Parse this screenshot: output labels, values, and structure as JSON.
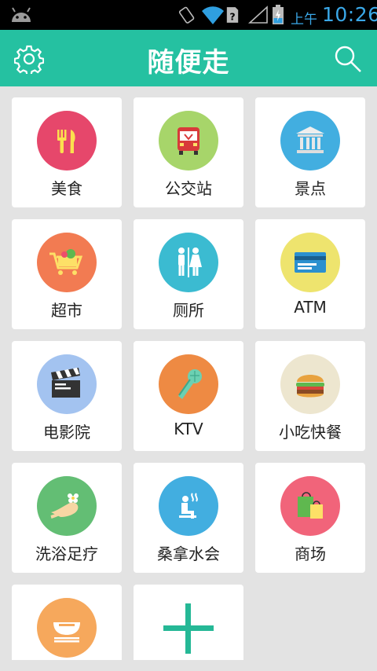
{
  "status_bar": {
    "ampm": "上午",
    "time": "10:26"
  },
  "header": {
    "title": "随便走"
  },
  "categories": [
    {
      "label": "美食",
      "icon": "cutlery-icon",
      "color": "#e6476b"
    },
    {
      "label": "公交站",
      "icon": "bus-icon",
      "color": "#a7d56a"
    },
    {
      "label": "景点",
      "icon": "landmark-icon",
      "color": "#42aee0"
    },
    {
      "label": "超市",
      "icon": "shopping-cart-icon",
      "color": "#f27b52"
    },
    {
      "label": "厕所",
      "icon": "restroom-icon",
      "color": "#3bbbd1"
    },
    {
      "label": "ATM",
      "icon": "credit-card-icon",
      "color": "#eee46e"
    },
    {
      "label": "电影院",
      "icon": "clapperboard-icon",
      "color": "#a3c3f0"
    },
    {
      "label": "KTV",
      "icon": "microphone-icon",
      "color": "#ee8a43"
    },
    {
      "label": "小吃快餐",
      "icon": "burger-icon",
      "color": "#ede6cf"
    },
    {
      "label": "洗浴足疗",
      "icon": "foot-spa-icon",
      "color": "#63be74"
    },
    {
      "label": "桑拿水会",
      "icon": "sauna-icon",
      "color": "#42aee0"
    },
    {
      "label": "商场",
      "icon": "shopping-bag-icon",
      "color": "#f1647a"
    },
    {
      "label": "",
      "icon": "bowl-icon",
      "color": "#f6a85c"
    }
  ],
  "add_tile": {
    "icon": "plus-icon",
    "color": "#25b896"
  }
}
